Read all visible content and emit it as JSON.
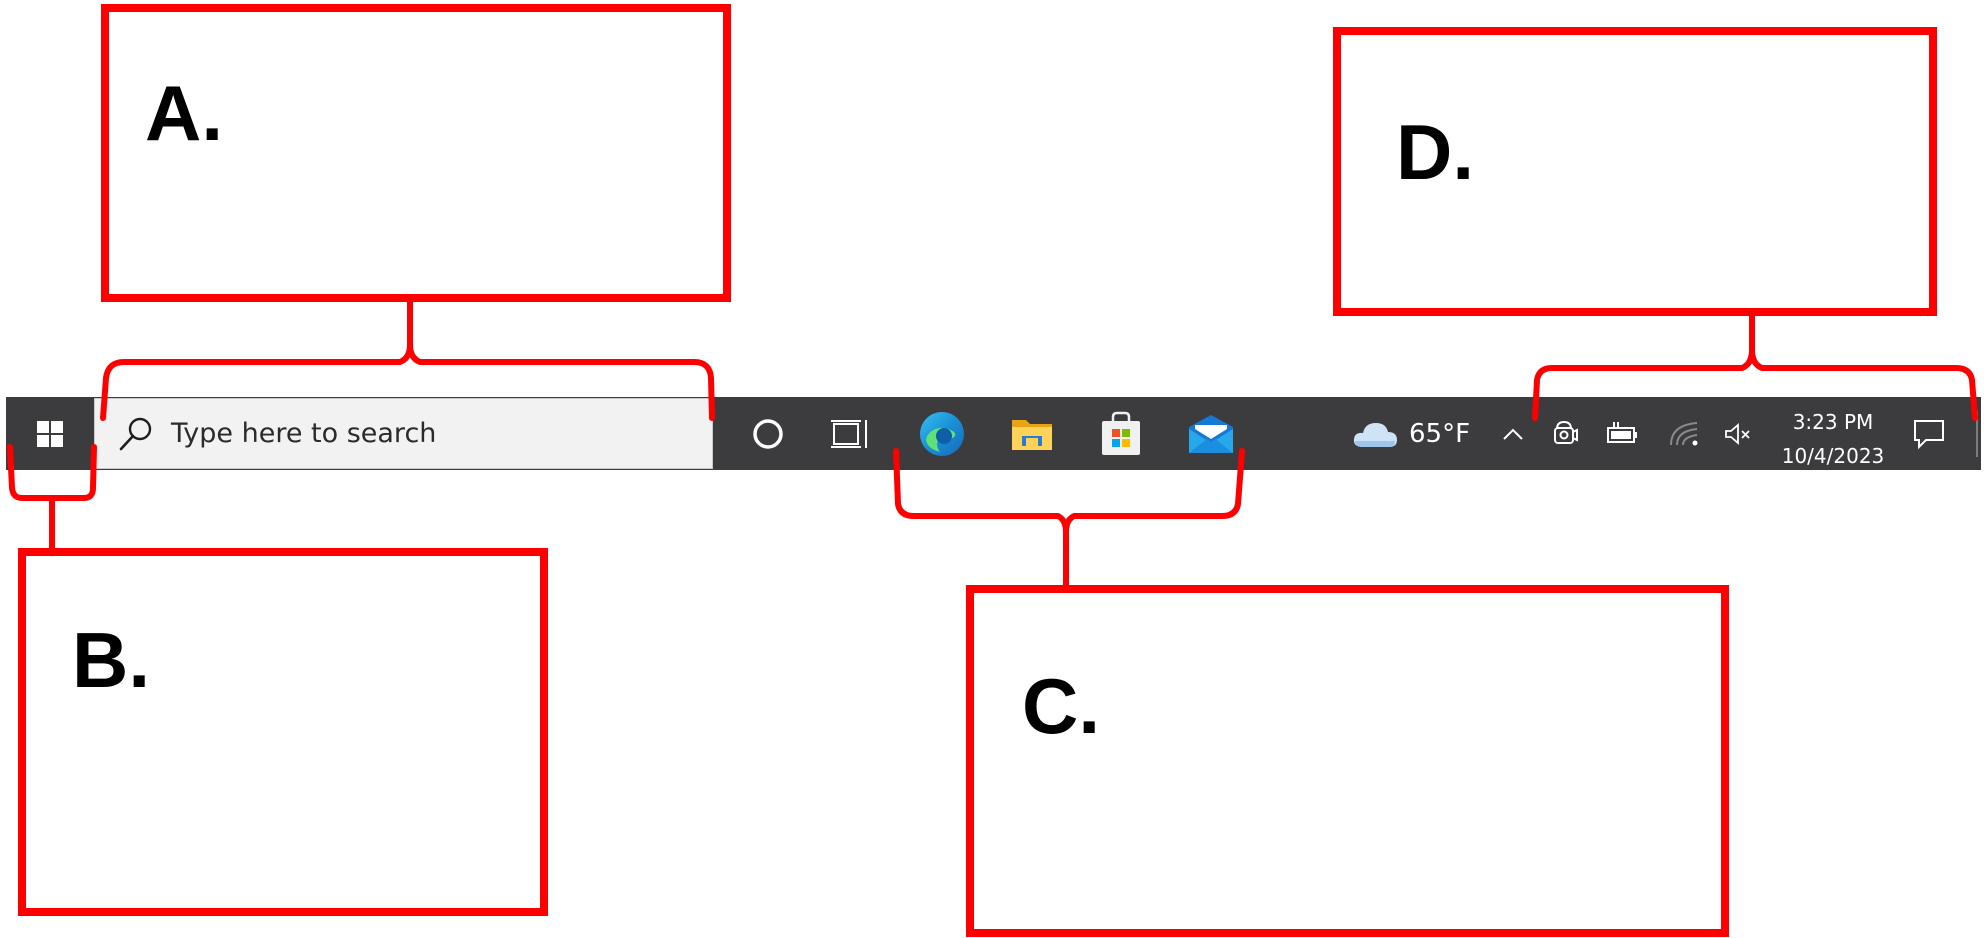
{
  "callouts": {
    "a": "A.",
    "b": "B.",
    "c": "C.",
    "d": "D."
  },
  "taskbar": {
    "search_placeholder": "Type here to search",
    "weather_temp": "65°F",
    "clock_time": "3:23 PM",
    "clock_date": "10/4/2023",
    "pinned_apps": [
      "edge-icon",
      "file-explorer-icon",
      "microsoft-store-icon",
      "mail-icon"
    ],
    "tray_icons": [
      "chevron-up-icon",
      "camera-mic-icon",
      "battery-charging-icon",
      "wifi-icon",
      "volume-muted-icon"
    ]
  },
  "colors": {
    "callout_red": "#ff0000",
    "taskbar_bg": "#3c3b3e",
    "search_bg": "#f2f2f2"
  }
}
